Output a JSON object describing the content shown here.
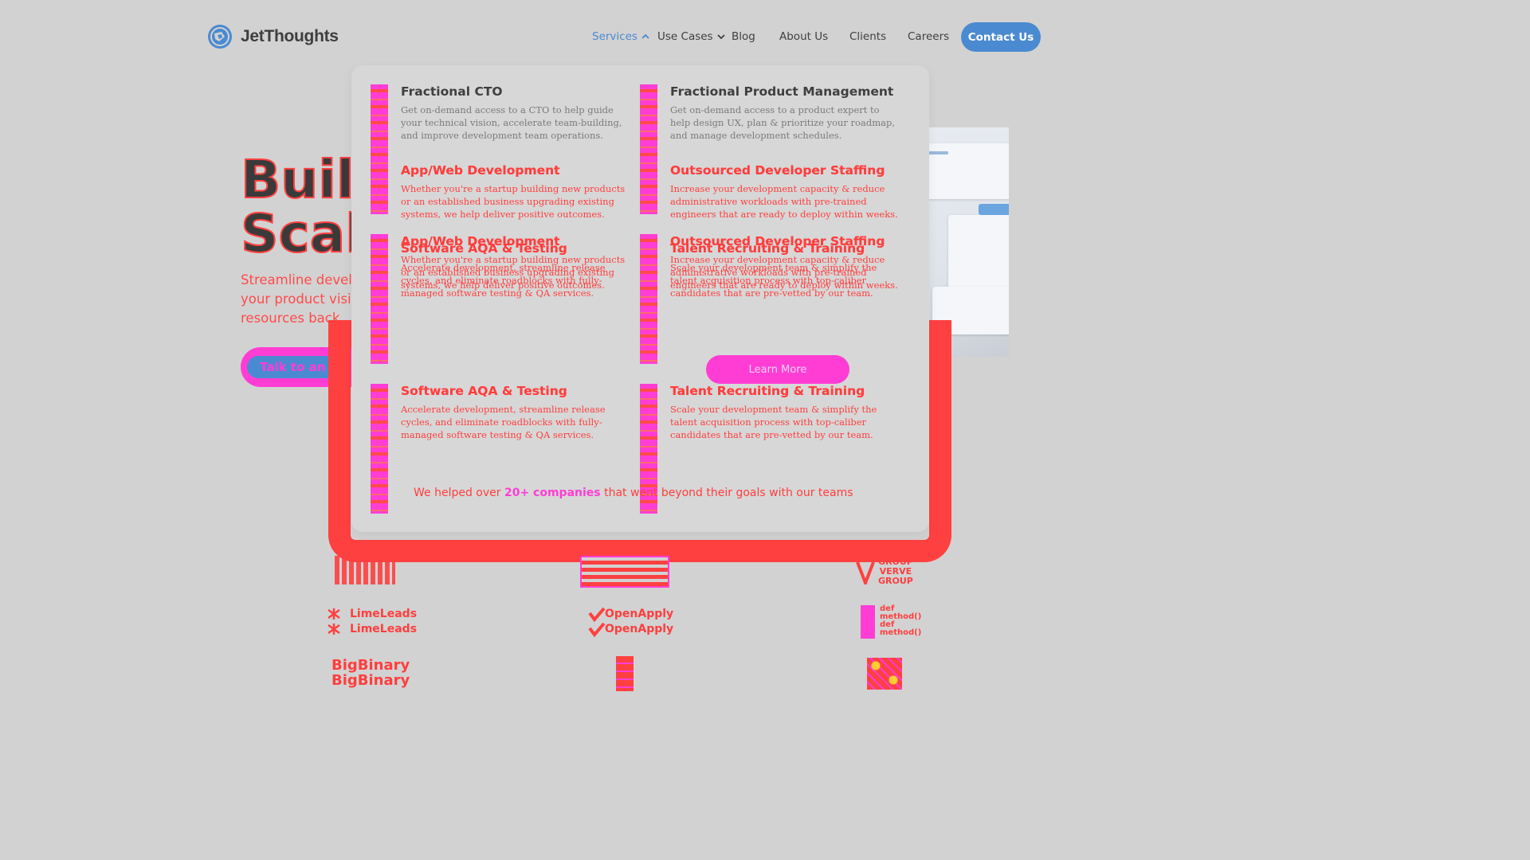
{
  "header": {
    "brand": "JetThoughts",
    "nav": [
      {
        "label": "Services",
        "active": true,
        "chevron": "up"
      },
      {
        "label": "Use Cases",
        "active": false,
        "chevron": "down"
      },
      {
        "label": "Blog"
      },
      {
        "label": "About Us"
      },
      {
        "label": "Clients"
      },
      {
        "label": "Careers"
      }
    ],
    "contact_label": "Contact Us"
  },
  "hero": {
    "title_line1": "Buil",
    "title_line2": "Scal",
    "subtitle_line1": "Streamline develo",
    "subtitle_line2": "your product visio",
    "subtitle_line3": "resources back",
    "cta_label": "Talk to an E"
  },
  "dropdown": {
    "services": [
      {
        "title": "Fractional CTO",
        "description": "Get on-demand access to a CTO to help guide your technical vision, accelerate team-building, and improve development team operations."
      },
      {
        "title": "Fractional Product Management",
        "description": "Get on-demand access to a product expert to help design UX, plan & prioritize your roadmap, and manage development schedules."
      },
      {
        "title": "App/Web Development",
        "description": "Whether you're a startup building new products or an established business upgrading existing systems, we help deliver positive outcomes."
      },
      {
        "title": "Outsourced Developer Staffing",
        "description": "Increase your development capacity & reduce administrative workloads with pre-trained engineers that are ready to deploy within weeks."
      },
      {
        "title": "Software AQA & Testing",
        "description": "Accelerate development, streamline release cycles, and eliminate roadblocks with fully-managed software testing & QA services."
      },
      {
        "title": "Talent Recruiting & Training",
        "description": "Scale your development team & simplify the talent acquisition process with top-caliber candidates that are pre-vetted by our team."
      }
    ]
  },
  "learn_more_label": "Learn More",
  "helped": {
    "prefix": "We helped over ",
    "highlight": "20+ companies",
    "suffix": " that went beyond their goals with our teams"
  },
  "logos": {
    "limeleads": "LimeLeads",
    "openapply": "OpenApply",
    "bigbinary": "BigBinary",
    "defmethod_line1": "def",
    "defmethod_line2": "method()",
    "group_line1": "GROUP",
    "group_line2": "VERVE",
    "group_line3": "GROUP"
  },
  "colors": {
    "accent_blue": "#4a8ad0",
    "highlight_red": "#ff4040",
    "highlight_magenta": "#ff3dd4",
    "background": "#d2d2d2"
  }
}
